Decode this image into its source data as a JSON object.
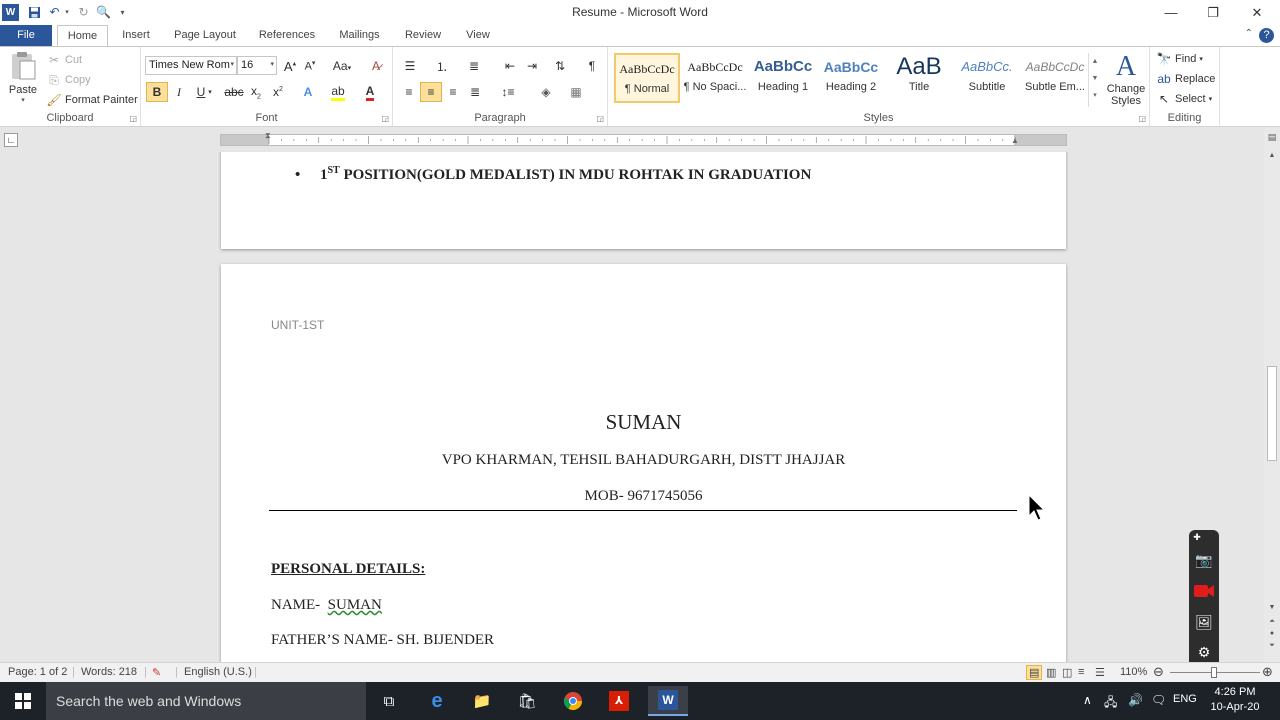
{
  "titlebar": {
    "title": "Resume - Microsoft Word",
    "qat": [
      "word-logo-icon",
      "save-icon",
      "undo-icon",
      "redo-icon",
      "print-preview-icon",
      "customize-qat-icon"
    ]
  },
  "tabs": [
    {
      "label": "File"
    },
    {
      "label": "Home"
    },
    {
      "label": "Insert"
    },
    {
      "label": "Page Layout"
    },
    {
      "label": "References"
    },
    {
      "label": "Mailings"
    },
    {
      "label": "Review"
    },
    {
      "label": "View"
    }
  ],
  "clipboard": {
    "label": "Clipboard",
    "paste": "Paste",
    "cut": "Cut",
    "copy": "Copy",
    "format_painter": "Format Painter"
  },
  "font": {
    "label": "Font",
    "family": "Times New Rom",
    "size": "16"
  },
  "paragraph": {
    "label": "Paragraph"
  },
  "styles": {
    "label": "Styles",
    "tiles": [
      {
        "preview": "AaBbCcDc",
        "name": "¶ Normal"
      },
      {
        "preview": "AaBbCcDc",
        "name": "¶ No Spaci..."
      },
      {
        "preview": "AaBbCc",
        "name": "Heading 1"
      },
      {
        "preview": "AaBbCc",
        "name": "Heading 2"
      },
      {
        "preview": "AaB",
        "name": "Title"
      },
      {
        "preview": "AaBbCc.",
        "name": "Subtitle"
      },
      {
        "preview": "AaBbCcDc",
        "name": "Subtle Em..."
      }
    ],
    "change_styles": "Change Styles"
  },
  "editing": {
    "label": "Editing",
    "find": "Find",
    "replace": "Replace",
    "select": "Select"
  },
  "document": {
    "page1_bullet_sup": "ST",
    "page1_bullet_prefix": "1",
    "page1_bullet_rest": " POSITION(GOLD MEDALIST) IN MDU ROHTAK IN GRADUATION",
    "header": "UNIT-1ST",
    "name": "SUMAN",
    "address": "VPO KHARMAN, TEHSIL BAHADURGARH, DISTT JHAJJAR",
    "mobile": "MOB- 9671745056",
    "section_personal": "PERSONAL DETAILS:",
    "name_line_label": "NAME-",
    "name_line_value": "SUMAN",
    "father_line": "FATHER’S NAME- SH. BIJENDER"
  },
  "statusbar": {
    "page": "Page: 1 of 2",
    "words": "Words: 218",
    "language": "English (U.S.)",
    "zoom": "110%"
  },
  "taskbar": {
    "search_placeholder": "Search the web and Windows",
    "language": "ENG",
    "time": "4:26 PM",
    "date": "10-Apr-20"
  },
  "colors": {
    "word_blue": "#2b579a",
    "taskbar": "#1d2128"
  }
}
